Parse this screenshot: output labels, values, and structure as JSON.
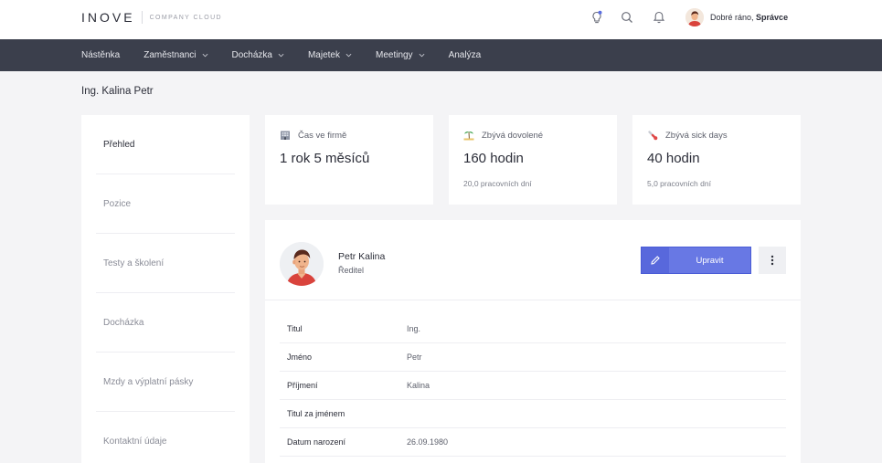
{
  "brand": {
    "name": "INOVE",
    "sub": "COMPANY CLOUD"
  },
  "topbar": {
    "icons": [
      "lightbulb-icon",
      "search-icon",
      "bell-icon",
      "avatar"
    ],
    "greeting": "Dobré ráno,",
    "user": "Správce"
  },
  "nav": {
    "items": [
      {
        "label": "Nástěnka",
        "dropdown": false
      },
      {
        "label": "Zaměstnanci",
        "dropdown": true
      },
      {
        "label": "Docházka",
        "dropdown": true
      },
      {
        "label": "Majetek",
        "dropdown": true
      },
      {
        "label": "Meetingy",
        "dropdown": true
      },
      {
        "label": "Analýza",
        "dropdown": false
      }
    ]
  },
  "page": {
    "title": "Ing. Kalina Petr"
  },
  "sidemenu": {
    "items": [
      {
        "label": "Přehled",
        "active": true
      },
      {
        "label": "Pozice"
      },
      {
        "label": "Testy a školení"
      },
      {
        "label": "Docházka"
      },
      {
        "label": "Mzdy a výplatní pásky"
      },
      {
        "label": "Kontaktní údaje"
      }
    ]
  },
  "stats": [
    {
      "icon": "building-icon",
      "label": "Čas ve firmě",
      "value": "1 rok 5 měsíců",
      "sub": ""
    },
    {
      "icon": "beach-icon",
      "label": "Zbývá dovolené",
      "value": "160 hodin",
      "sub": "20,0 pracovních dní"
    },
    {
      "icon": "thermometer-icon",
      "label": "Zbývá sick days",
      "value": "40 hodin",
      "sub": "5,0 pracovních dní"
    }
  ],
  "profile": {
    "name": "Petr Kalina",
    "role": "Ředitel",
    "edit_label": "Upravit",
    "details": [
      {
        "key": "Titul",
        "value": "Ing."
      },
      {
        "key": "Jméno",
        "value": "Petr"
      },
      {
        "key": "Příjmení",
        "value": "Kalina"
      },
      {
        "key": "Titul za jménem",
        "value": ""
      },
      {
        "key": "Datum narození",
        "value": "26.09.1980"
      }
    ]
  },
  "colors": {
    "nav_bg": "#3b3f4c",
    "accent": "#6878e4",
    "page_bg": "#f4f4f6"
  }
}
